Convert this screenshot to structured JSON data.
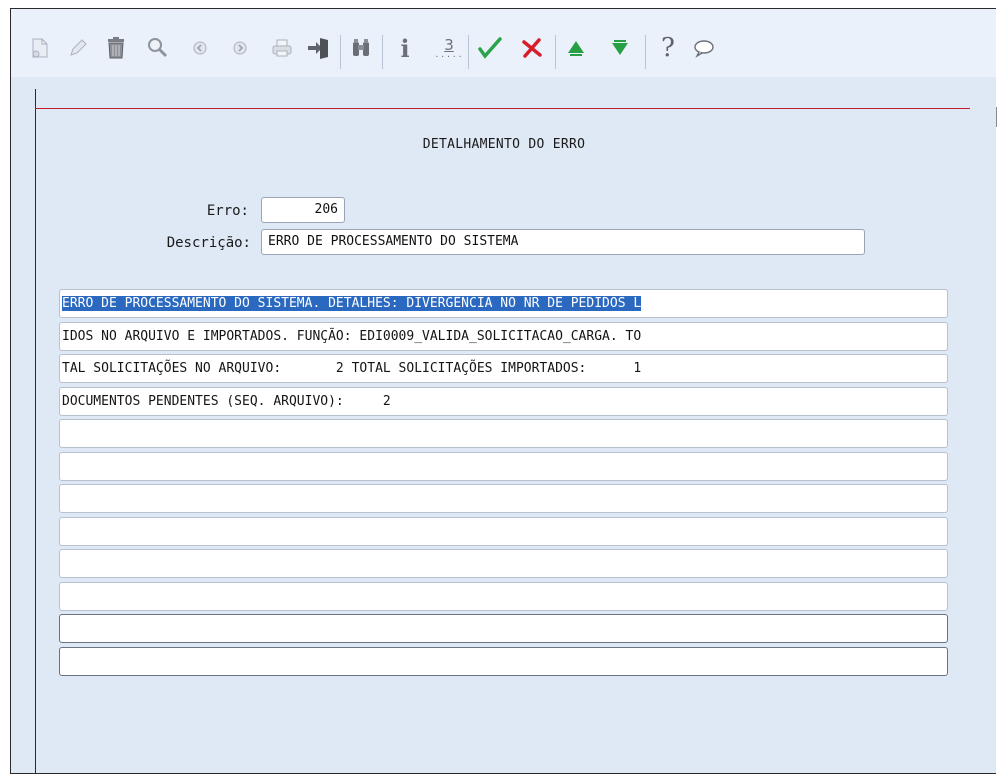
{
  "toolbar": {
    "icons": [
      "new-doc-icon",
      "edit-icon",
      "trash-icon",
      "search-icon",
      "prev-icon",
      "next-icon",
      "print-icon",
      "exit-door-icon",
      "binoculars-icon",
      "info-icon",
      "numbering-icon",
      "confirm-check-icon",
      "cancel-x-icon",
      "move-up-icon",
      "move-down-icon",
      "help-icon",
      "chat-icon"
    ],
    "info_glyph": "i",
    "numbering_glyph": "3",
    "help_glyph": "?"
  },
  "form": {
    "title": "DETALHAMENTO DO ERRO",
    "erro_label": "Erro:",
    "erro_value": "206",
    "descricao_label": "Descrição:",
    "descricao_value": "ERRO DE PROCESSAMENTO DO SISTEMA"
  },
  "details": {
    "rows": [
      "ERRO DE PROCESSAMENTO DO SISTEMA. DETALHES: DIVERGÊNCIA NO NR DE PEDIDOS L",
      "IDOS NO ARQUIVO E IMPORTADOS. FUNÇÃO: EDI0009_VALIDA_SOLICITACAO_CARGA. TO",
      "TAL SOLICITAÇÕES NO ARQUIVO:       2 TOTAL SOLICITAÇÕES IMPORTADOS:      1",
      "DOCUMENTOS PENDENTES (SEQ. ARQUIVO):     2",
      "",
      "",
      "",
      "",
      "",
      "",
      "",
      ""
    ]
  },
  "colors": {
    "accent_red": "#c0202a",
    "selection": "#2b69c0",
    "panel_bg": "#dfe8f5",
    "green": "#2aa34a"
  }
}
